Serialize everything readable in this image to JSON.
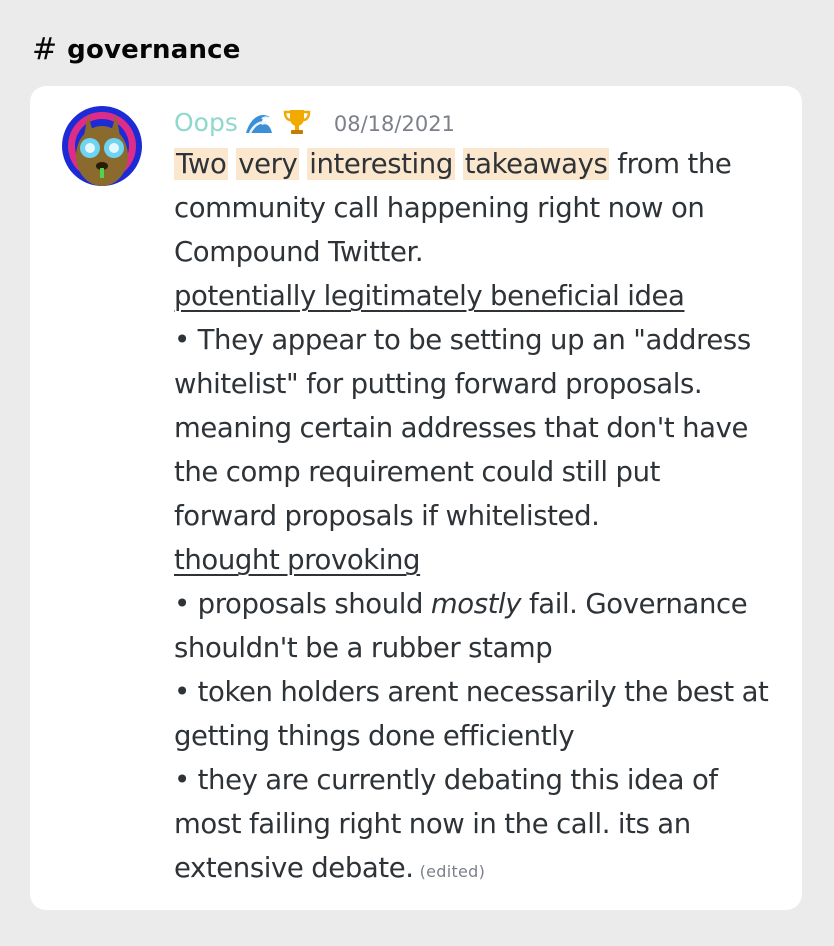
{
  "channel": {
    "hash": "#",
    "name": "governance"
  },
  "message": {
    "author": "Oops",
    "badges": [
      "wave-emoji",
      "trophy-emoji"
    ],
    "timestamp": "08/18/2021",
    "highlighted_words": [
      "Two",
      "very",
      "interesting",
      "takeaways"
    ],
    "line1_rest": "from the",
    "line2": "community call happening right now on",
    "line3": "Compound Twitter.",
    "heading1": "potentially legitimately beneficial idea",
    "bullet1_l1": "• They appear to be setting up an \"address",
    "bullet1_l2": "whitelist\" for putting forward proposals.",
    "bullet1_l3": "meaning certain addresses that don't have",
    "bullet1_l4": "the comp requirement could still put",
    "bullet1_l5": "forward proposals if whitelisted.",
    "heading2": "thought provoking",
    "bullet2_pre": "• proposals should ",
    "bullet2_em": "mostly",
    "bullet2_post": " fail. Governance",
    "bullet2_l2": "shouldn't be a rubber stamp",
    "bullet3_l1": "• token holders arent necessarily the best at",
    "bullet3_l2": "getting things done efficiently",
    "bullet4_l1": "• they are currently debating this idea of",
    "bullet4_l2": "most failing right now in the call. its an",
    "bullet4_l3": "extensive debate.",
    "edited": "(edited)"
  },
  "colors": {
    "background": "#ebebeb",
    "card": "#ffffff",
    "username": "#8fd8cc",
    "highlight": "#fbe7cd",
    "text": "#2e3338",
    "muted": "#7b808a"
  }
}
